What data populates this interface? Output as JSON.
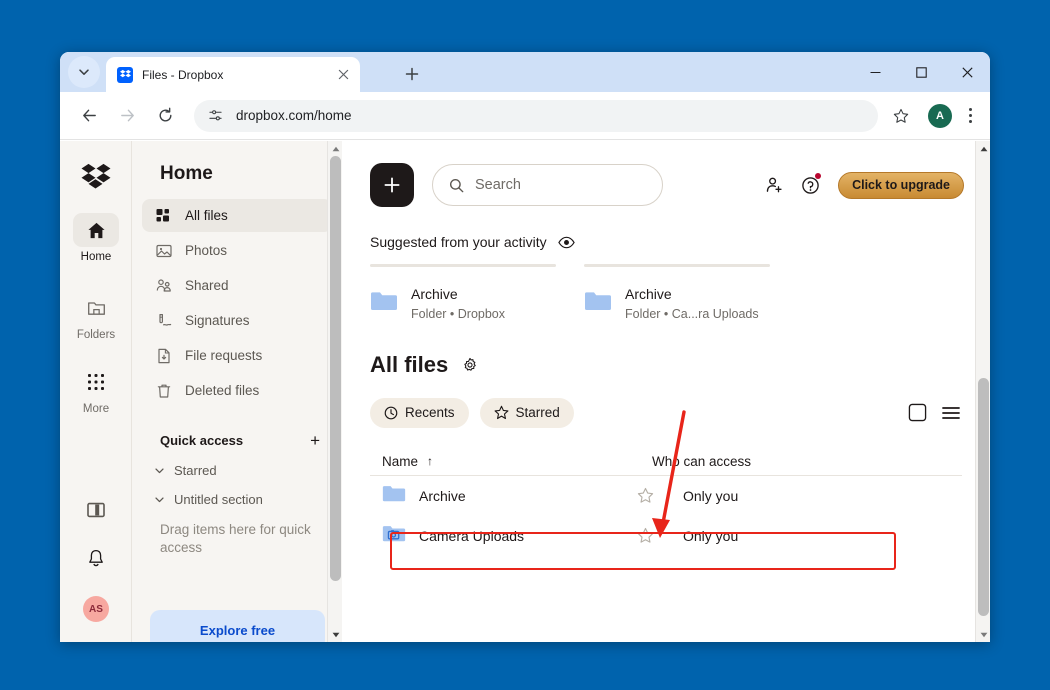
{
  "browser": {
    "tab": {
      "title": "Files - Dropbox",
      "favicon": "dropbox-favicon",
      "close": "close-icon"
    },
    "new_tab_label": "+",
    "window_controls": {
      "minimize": "minimize-icon",
      "maximize": "maximize-icon",
      "close": "close-icon"
    },
    "omnibox": {
      "url": "dropbox.com/home",
      "site_settings_icon": "site-settings-icon"
    },
    "nav": {
      "back": "back-arrow-icon",
      "forward": "forward-arrow-icon",
      "reload": "reload-icon"
    },
    "bookmark_icon": "star-icon",
    "profile_initial": "A",
    "menu_icon": "kebab-menu-icon"
  },
  "rail": {
    "logo": "dropbox-logo-icon",
    "items": [
      {
        "label": "Home",
        "icon": "home-icon",
        "active": true
      },
      {
        "label": "Folders",
        "icon": "folder-icon",
        "active": false
      },
      {
        "label": "More",
        "icon": "grid-dots-icon",
        "active": false
      }
    ],
    "bottom": [
      {
        "name": "panel-toggle",
        "icon": "sidebar-panel-icon"
      },
      {
        "name": "notifications",
        "icon": "bell-icon"
      }
    ],
    "avatar_initials": "AS"
  },
  "sidebar": {
    "title": "Home",
    "items": [
      {
        "label": "All files",
        "icon": "all-files-icon",
        "active": true
      },
      {
        "label": "Photos",
        "icon": "photos-icon",
        "active": false
      },
      {
        "label": "Shared",
        "icon": "shared-icon",
        "active": false
      },
      {
        "label": "Signatures",
        "icon": "signature-icon",
        "active": false
      },
      {
        "label": "File requests",
        "icon": "file-request-icon",
        "active": false
      },
      {
        "label": "Deleted files",
        "icon": "trash-icon",
        "active": false
      }
    ],
    "quick_access": {
      "title": "Quick access",
      "add_label": "+"
    },
    "sections": [
      {
        "label": "Starred",
        "icon": "chevron-down-icon"
      },
      {
        "label": "Untitled section",
        "icon": "chevron-down-icon"
      }
    ],
    "drag_hint": "Drag items here for quick access",
    "explore_free": "Explore free"
  },
  "main": {
    "create_button": "+",
    "search": {
      "placeholder": "Search",
      "icon": "search-icon"
    },
    "invite_icon": "add-person-icon",
    "help_icon": "help-circle-icon",
    "upgrade_button": "Click to upgrade",
    "suggested": {
      "label": "Suggested from your activity",
      "hide_icon": "eye-icon",
      "cards": [
        {
          "name": "Archive",
          "meta": "Folder • Dropbox",
          "icon": "folder-icon"
        },
        {
          "name": "Archive",
          "meta": "Folder • Ca...ra Uploads",
          "icon": "folder-icon"
        }
      ]
    },
    "section": {
      "title": "All files",
      "settings_icon": "gear-icon"
    },
    "filters": [
      {
        "label": "Recents",
        "icon": "clock-icon"
      },
      {
        "label": "Starred",
        "icon": "star-icon"
      }
    ],
    "view_toggles": [
      {
        "name": "grid-view",
        "icon": "square-icon"
      },
      {
        "name": "list-view",
        "icon": "list-icon"
      }
    ],
    "table": {
      "columns": [
        {
          "label": "Name",
          "sort": "↑"
        },
        {
          "label": "Who can access"
        }
      ],
      "rows": [
        {
          "name": "Archive",
          "icon": "folder-icon",
          "star": "star-outline-icon",
          "access": "Only you",
          "highlighted": false
        },
        {
          "name": "Camera Uploads",
          "icon": "camera-folder-icon",
          "star": "star-outline-icon",
          "access": "Only you",
          "highlighted": true
        }
      ]
    }
  },
  "annotation": {
    "arrow_color": "#e8251a",
    "highlight_color": "#e8251a",
    "target": "Camera Uploads"
  },
  "colors": {
    "desktop_background": "#0063ad",
    "sidebar_background": "#f7f5f2",
    "accent_blue": "#0061fe",
    "upgrade_gold": "#c88a33",
    "annotation_red": "#e8251a"
  }
}
